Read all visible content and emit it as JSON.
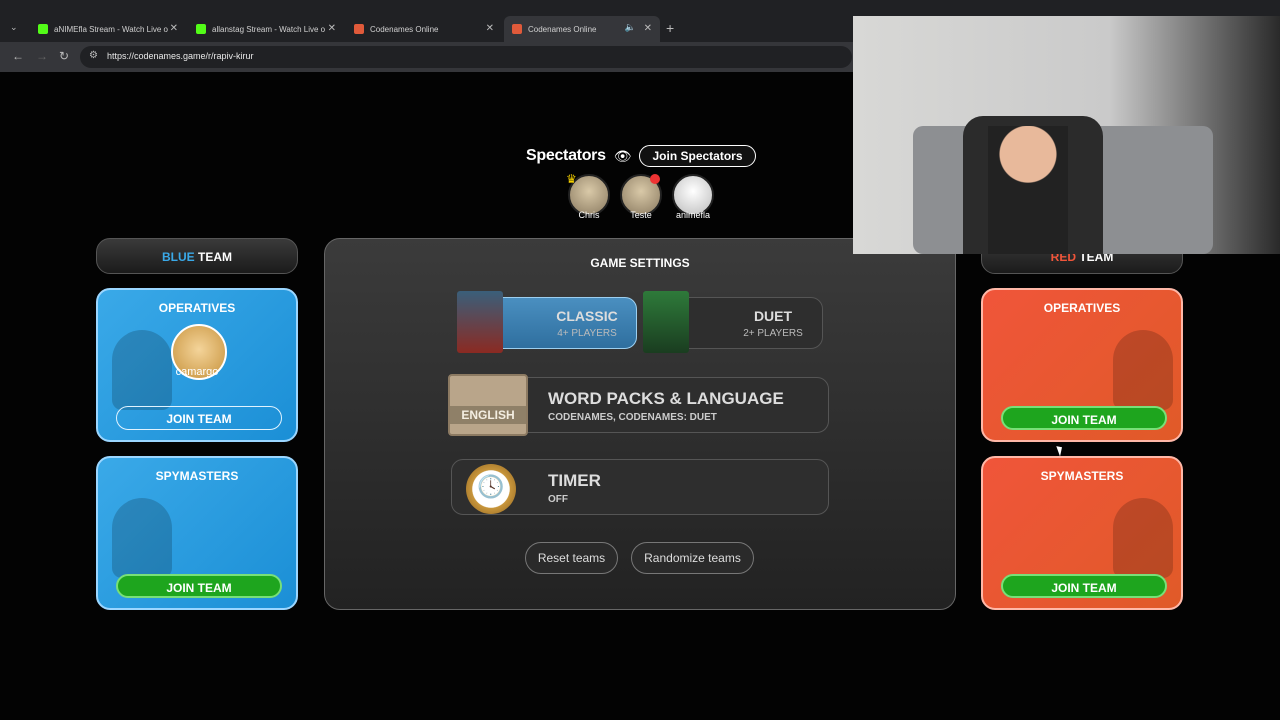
{
  "browser": {
    "tabs": [
      {
        "label": "aNIMEfla Stream - Watch Live o",
        "favicon_color": "#53fc18"
      },
      {
        "label": "allanstag Stream - Watch Live o",
        "favicon_color": "#53fc18"
      },
      {
        "label": "Codenames Online",
        "favicon_color": "#e05a3a"
      },
      {
        "label": "Codenames Online",
        "favicon_color": "#e05a3a"
      }
    ],
    "url": "https://codenames.game/r/rapiv-kirur"
  },
  "spectators": {
    "title": "Spectators",
    "join_label": "Join Spectators",
    "users": [
      "Chris",
      "Teste",
      "animefla"
    ]
  },
  "blue_team": {
    "header_word": "BLUE",
    "header_suffix": "TEAM",
    "color": "#3aa9e8",
    "operatives": {
      "title": "OPERATIVES",
      "members": [
        "camargo"
      ],
      "join_label": "JOIN TEAM"
    },
    "spymasters": {
      "title": "SPYMASTERS",
      "join_label": "JOIN TEAM"
    }
  },
  "red_team": {
    "header_word": "RED",
    "header_suffix": "TEAM",
    "color": "#f0553a",
    "operatives": {
      "title": "OPERATIVES",
      "join_label": "JOIN TEAM"
    },
    "spymasters": {
      "title": "SPYMASTERS",
      "join_label": "JOIN TEAM"
    }
  },
  "settings": {
    "title": "GAME SETTINGS",
    "modes": [
      {
        "name": "CLASSIC",
        "players": "4+ PLAYERS",
        "selected": true
      },
      {
        "name": "DUET",
        "players": "2+ PLAYERS",
        "selected": false
      }
    ],
    "word_packs": {
      "title": "WORD PACKS & LANGUAGE",
      "value": "CODENAMES, CODENAMES: DUET",
      "language": "ENGLISH"
    },
    "timer": {
      "title": "TIMER",
      "value": "OFF"
    },
    "reset_label": "Reset teams",
    "randomize_label": "Randomize teams"
  }
}
